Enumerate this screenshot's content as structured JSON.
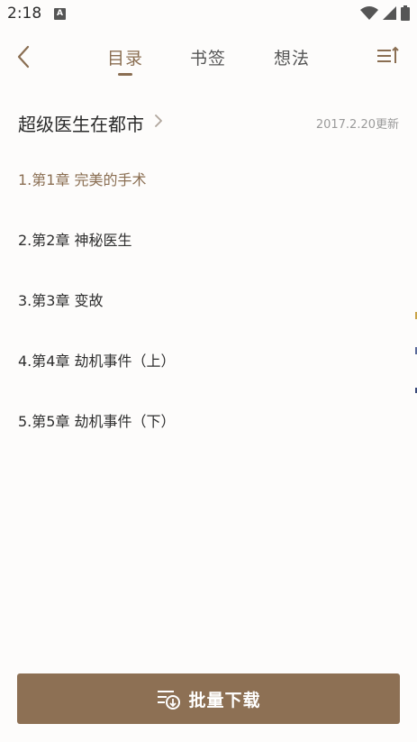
{
  "status_bar": {
    "time": "2:18",
    "notification_badge": "A",
    "icons": [
      "wifi-icon",
      "signal-icon",
      "battery-icon"
    ]
  },
  "header": {
    "tabs": [
      {
        "label": "目录",
        "active": true
      },
      {
        "label": "书签",
        "active": false
      },
      {
        "label": "想法",
        "active": false
      }
    ],
    "back_icon": "chevron-left-icon",
    "sort_icon": "sort-list-icon"
  },
  "book": {
    "title": "超级医生在都市",
    "updated": "2017.2.20更新"
  },
  "chapters": [
    {
      "label": "1.第1章 完美的手术",
      "current": true
    },
    {
      "label": "2.第2章 神秘医生",
      "current": false
    },
    {
      "label": "3.第3章 变故",
      "current": false
    },
    {
      "label": "4.第4章 劫机事件（上）",
      "current": false
    },
    {
      "label": "5.第5章 劫机事件（下）",
      "current": false
    }
  ],
  "download": {
    "label": "批量下载",
    "icon": "download-list-icon"
  },
  "colors": {
    "accent": "#8a6e52",
    "button": "#8d7054",
    "text": "#2e2e2e",
    "muted": "#9a9a9a"
  }
}
